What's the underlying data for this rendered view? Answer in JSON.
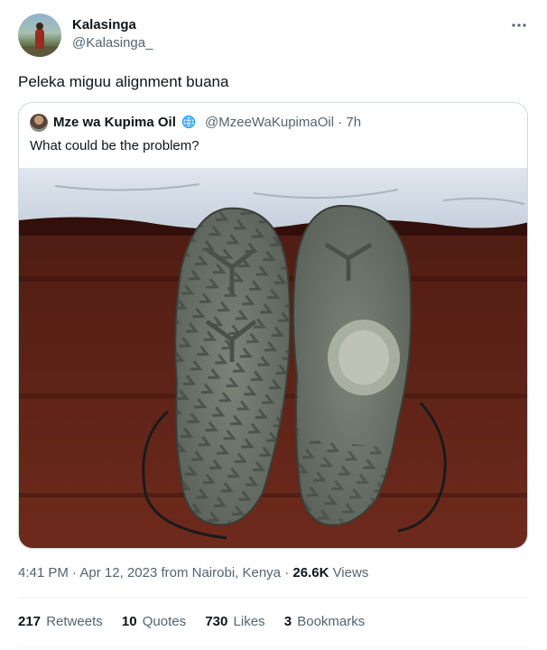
{
  "tweet": {
    "author": {
      "name": "Kalasinga",
      "handle": "@Kalasinga_"
    },
    "more_icon": "more-horizontal-icon",
    "text": "Peleka miguu alignment buana",
    "quoted": {
      "author_name": "Mze wa Kupima Oil",
      "verified_icon": "globe-icon",
      "handle_time": "@MzeeWaKupimaOil · 7h",
      "text": "What could be the problem?",
      "media_description": ""
    },
    "meta": {
      "time": "4:41 PM",
      "date": "Apr 12, 2023",
      "location": "from Nairobi, Kenya",
      "views_count": "26.6K",
      "views_label": "Views"
    },
    "stats": {
      "retweets": {
        "count": "217",
        "label": "Retweets"
      },
      "quotes": {
        "count": "10",
        "label": "Quotes"
      },
      "likes": {
        "count": "730",
        "label": "Likes"
      },
      "bookmarks": {
        "count": "3",
        "label": "Bookmarks"
      }
    }
  },
  "colors": {
    "text_primary": "#0f1419",
    "text_secondary": "#536471",
    "border": "#cfd9de",
    "divider": "#eff3f4"
  }
}
